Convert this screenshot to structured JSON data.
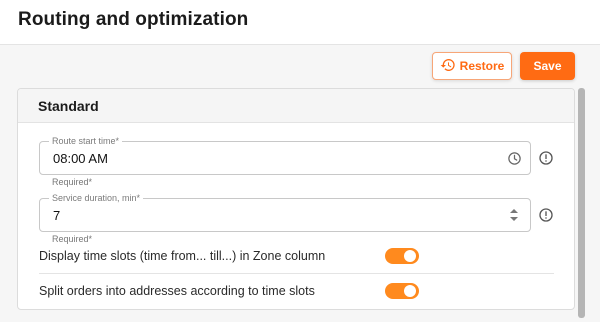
{
  "header": {
    "title": "Routing and optimization"
  },
  "toolbar": {
    "restore_label": "Restore",
    "save_label": "Save"
  },
  "section": {
    "title": "Standard"
  },
  "fields": [
    {
      "label": "Route start time*",
      "value": "08:00 AM",
      "helper": "Required*",
      "icon": "clock-icon"
    },
    {
      "label": "Service duration, min*",
      "value": "7",
      "helper": "Required*",
      "icon": "stepper-icon"
    }
  ],
  "toggles": [
    {
      "label": "Display time slots (time from... till...) in Zone column",
      "on": true
    },
    {
      "label": "Split orders into addresses according to time slots",
      "on": true
    }
  ],
  "colors": {
    "accent": "#ff6b13",
    "toggle_on": "#ff8a1e"
  }
}
